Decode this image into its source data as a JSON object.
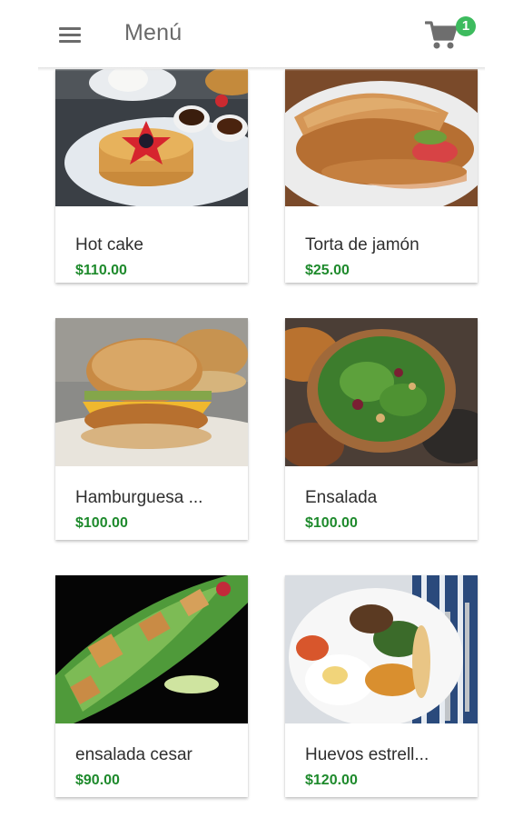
{
  "header": {
    "title": "Menú",
    "cart_count": "1",
    "cart_icon": "shopping-cart-icon",
    "menu_icon": "hamburger-menu-icon",
    "accent_color": "#3dbb5e"
  },
  "products": [
    {
      "name": "Hot cake",
      "price": "$110.00"
    },
    {
      "name": "Torta de jamón",
      "price": "$25.00"
    },
    {
      "name": "Hamburguesa ...",
      "price": "$100.00"
    },
    {
      "name": "Ensalada",
      "price": "$100.00"
    },
    {
      "name": "ensalada cesar",
      "price": "$90.00"
    },
    {
      "name": "Huevos estrell...",
      "price": "$120.00"
    }
  ],
  "price_color": "#1e8a2c"
}
